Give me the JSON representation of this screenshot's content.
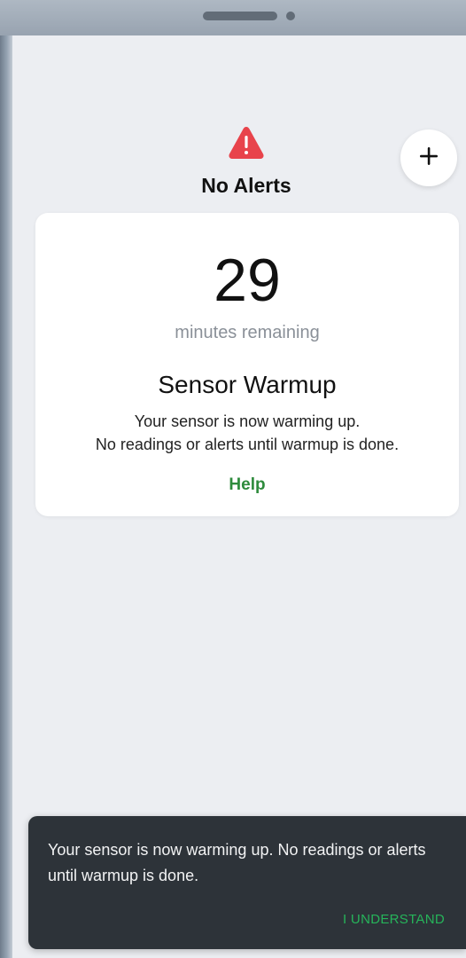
{
  "header": {
    "alert_icon": "warning-triangle-icon",
    "status_title": "No Alerts",
    "add_icon": "plus-icon"
  },
  "warmup_card": {
    "minutes_value": "29",
    "minutes_label": "minutes remaining",
    "title": "Sensor Warmup",
    "description_line1": "Your sensor is now warming up.",
    "description_line2": "No readings or alerts until warmup is done.",
    "help_link": "Help"
  },
  "snackbar": {
    "message": "Your sensor is now warming up. No readings or alerts until warmup is done.",
    "action_label": "I UNDERSTAND"
  },
  "colors": {
    "alert_red": "#e8434b",
    "link_green": "#2e8b3c",
    "snackbar_bg": "#2d3339",
    "snackbar_action": "#26b45a"
  }
}
